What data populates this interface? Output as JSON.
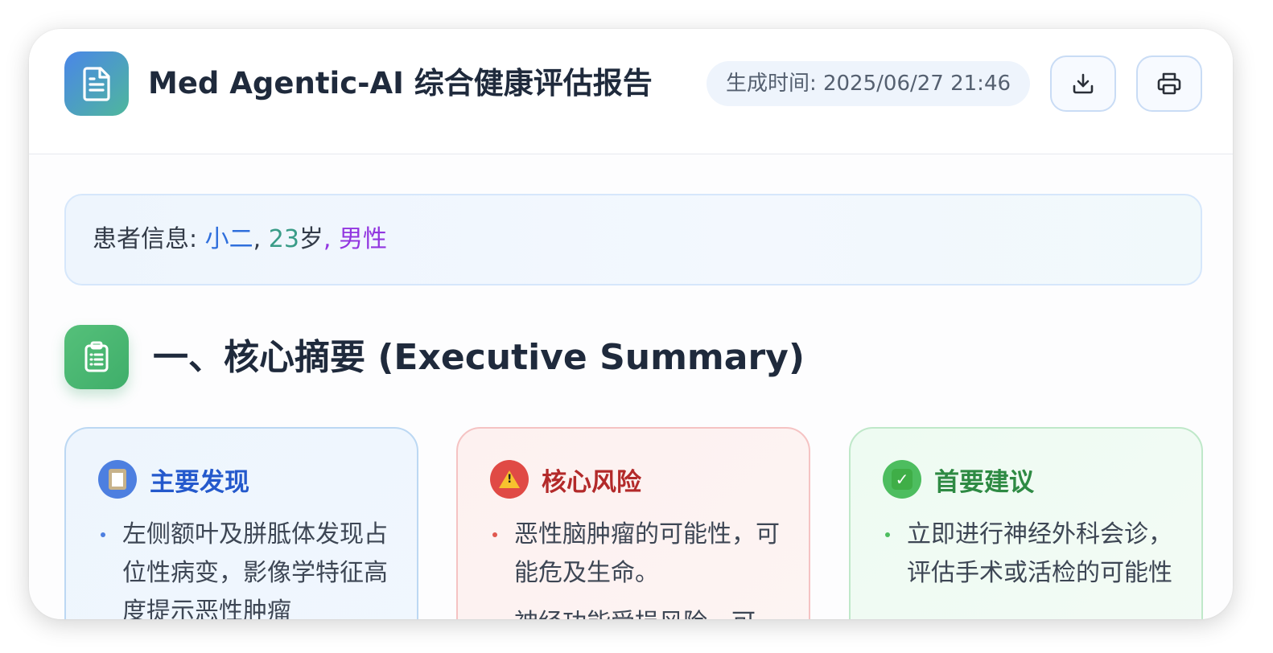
{
  "header": {
    "title": "Med Agentic-AI 综合健康评估报告",
    "generated_label": "生成时间: 2025/06/27 21:46",
    "icons": {
      "logo": "document-icon",
      "download": "download-icon",
      "print": "printer-icon"
    }
  },
  "patient": {
    "label": "患者信息: ",
    "name": "小二",
    "sep1": ", ",
    "age": "23",
    "age_unit": "岁",
    "sex": ", 男性"
  },
  "section1": {
    "title": "一、核心摘要 (Executive Summary)",
    "icon": "clipboard-icon"
  },
  "panels": [
    {
      "title": "主要发现",
      "icon": "clipboard-emoji-icon",
      "color": "#2459cc",
      "items": [
        "左侧额叶及胼胝体发现占位性病变，影像学特征高度提示恶性肿瘤"
      ]
    },
    {
      "title": "核心风险",
      "icon": "warning-icon",
      "color": "#b32a2a",
      "items": [
        "恶性脑肿瘤的可能性，可能危及生命。",
        "神经功能受损风险，可"
      ]
    },
    {
      "title": "首要建议",
      "icon": "check-box-icon",
      "color": "#2e8a43",
      "items": [
        "立即进行神经外科会诊，评估手术或活检的可能性"
      ]
    }
  ]
}
